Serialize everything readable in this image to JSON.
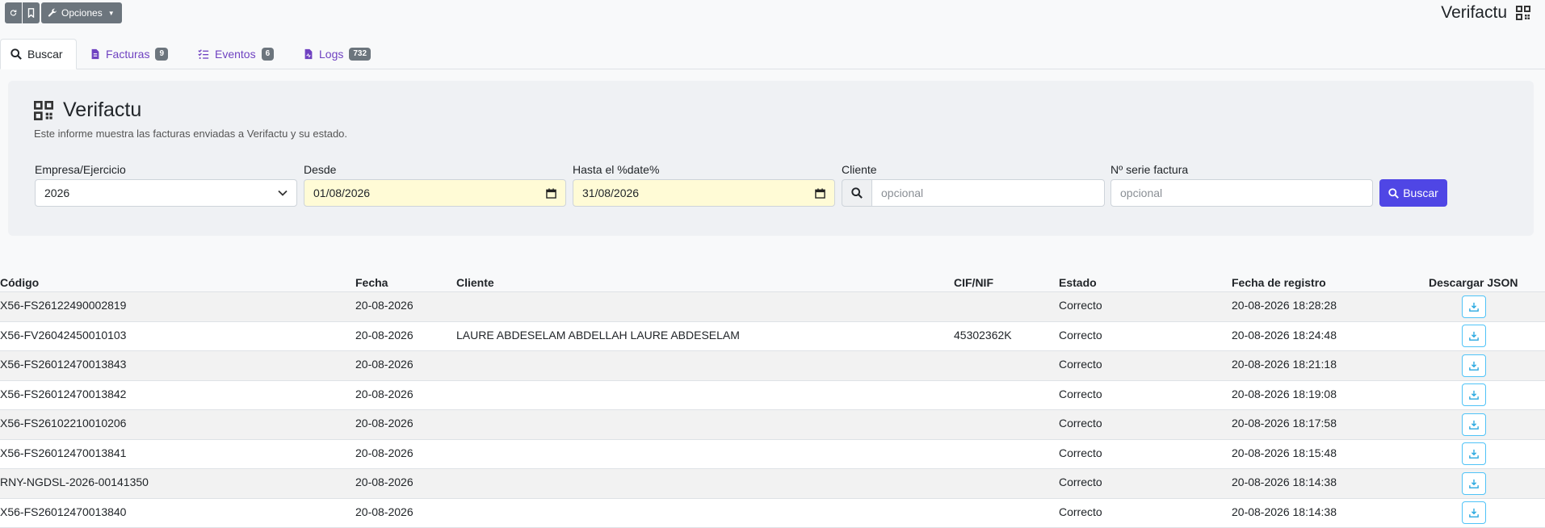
{
  "toolbar": {
    "options_label": "Opciones",
    "app_title": "Verifactu"
  },
  "tabs": [
    {
      "label": "Buscar",
      "badge": ""
    },
    {
      "label": "Facturas",
      "badge": "9"
    },
    {
      "label": "Eventos",
      "badge": "6"
    },
    {
      "label": "Logs",
      "badge": "732"
    }
  ],
  "panel": {
    "title": "Verifactu",
    "description": "Este informe muestra las facturas enviadas a Verifactu y su estado.",
    "fields": {
      "empresa": {
        "label": "Empresa/Ejercicio",
        "value": "2026"
      },
      "desde": {
        "label": "Desde",
        "value": "01/08/2026"
      },
      "hasta": {
        "label": "Hasta el %date%",
        "value": "31/08/2026"
      },
      "cliente": {
        "label": "Cliente",
        "placeholder": "opcional"
      },
      "serie": {
        "label": "Nº serie factura",
        "placeholder": "opcional"
      }
    },
    "search_label": "Buscar"
  },
  "table": {
    "headers": {
      "codigo": "Código",
      "fecha": "Fecha",
      "cliente": "Cliente",
      "cif": "CIF/NIF",
      "estado": "Estado",
      "registro": "Fecha de registro",
      "json": "Descargar JSON"
    },
    "rows": [
      {
        "codigo": "X56-FS26122490002819",
        "fecha": "20-08-2026",
        "cliente": "",
        "cif": "",
        "estado": "Correcto",
        "registro": "20-08-2026 18:28:28"
      },
      {
        "codigo": "X56-FV26042450010103",
        "fecha": "20-08-2026",
        "cliente": "LAURE ABDESELAM ABDELLAH LAURE ABDESELAM",
        "cif": "45302362K",
        "estado": "Correcto",
        "registro": "20-08-2026 18:24:48"
      },
      {
        "codigo": "X56-FS26012470013843",
        "fecha": "20-08-2026",
        "cliente": "",
        "cif": "",
        "estado": "Correcto",
        "registro": "20-08-2026 18:21:18"
      },
      {
        "codigo": "X56-FS26012470013842",
        "fecha": "20-08-2026",
        "cliente": "",
        "cif": "",
        "estado": "Correcto",
        "registro": "20-08-2026 18:19:08"
      },
      {
        "codigo": "X56-FS26102210010206",
        "fecha": "20-08-2026",
        "cliente": "",
        "cif": "",
        "estado": "Correcto",
        "registro": "20-08-2026 18:17:58"
      },
      {
        "codigo": "X56-FS26012470013841",
        "fecha": "20-08-2026",
        "cliente": "",
        "cif": "",
        "estado": "Correcto",
        "registro": "20-08-2026 18:15:48"
      },
      {
        "codigo": "RNY-NGDSL-2026-00141350",
        "fecha": "20-08-2026",
        "cliente": "",
        "cif": "",
        "estado": "Correcto",
        "registro": "20-08-2026 18:14:38"
      },
      {
        "codigo": "X56-FS26012470013840",
        "fecha": "20-08-2026",
        "cliente": "",
        "cif": "",
        "estado": "Correcto",
        "registro": "20-08-2026 18:14:38"
      }
    ]
  },
  "icons": {
    "refresh": "refresh-icon",
    "bookmark": "bookmark-icon",
    "wrench": "wrench-icon",
    "qrcode": "qrcode-icon",
    "search": "search-icon",
    "file": "file-invoice-icon",
    "list": "list-check-icon",
    "log": "file-log-icon",
    "calendar": "calendar-icon",
    "download": "download-icon"
  },
  "colors": {
    "accent": "#4f46e5",
    "tab_link": "#6f42c1",
    "badge": "#6c757d",
    "date_fill": "#fffbd6",
    "download_border": "#4fc3f7"
  }
}
